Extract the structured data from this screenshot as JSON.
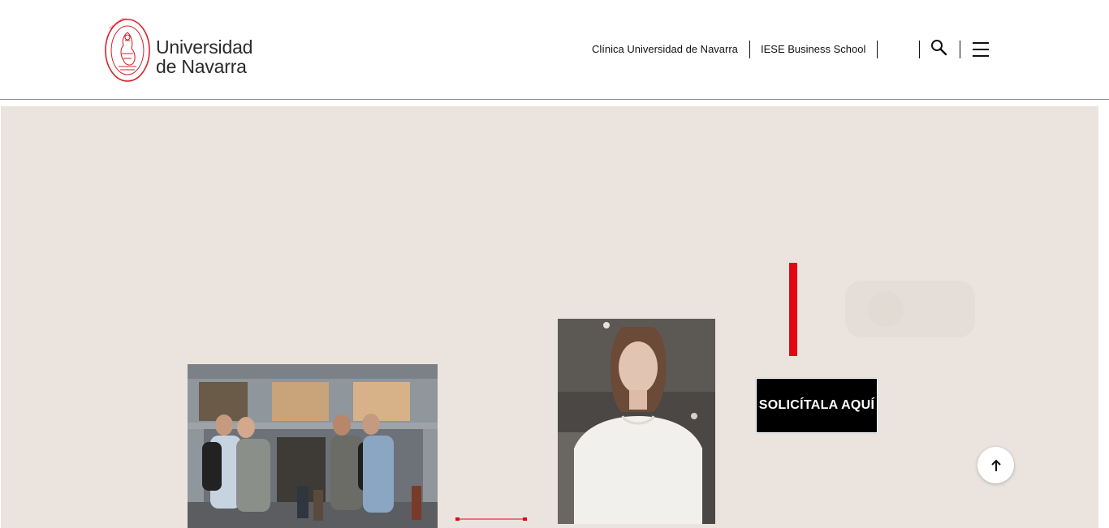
{
  "header": {
    "logo": {
      "line1": "Universidad",
      "line2": "de Navarra"
    },
    "links": [
      {
        "label": "Clínica Universidad de Navarra"
      },
      {
        "label": "IESE Business School"
      }
    ],
    "icons": {
      "search": "search-icon",
      "menu": "hamburger-menu-icon"
    }
  },
  "hero": {
    "cta_label": "SOLICÍTALA AQUÍ",
    "scroll_top": "arrow-up-icon"
  },
  "colors": {
    "brand_red": "#e30613",
    "hero_background": "#ebe4de",
    "cta_background": "#000000"
  }
}
